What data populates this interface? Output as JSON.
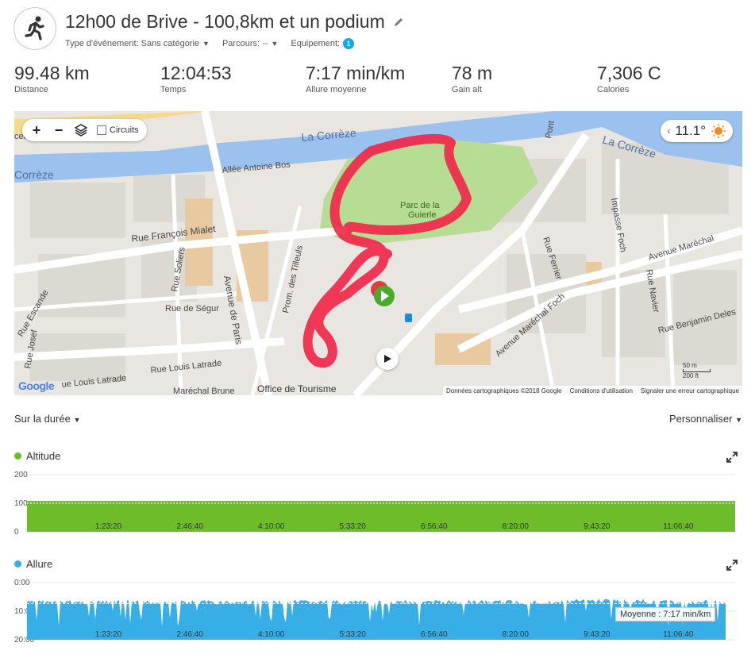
{
  "header": {
    "title": "12h00 de Brive - 100,8km et un podium",
    "meta": [
      {
        "label": "Type d'événement: Sans catégorie"
      },
      {
        "label": "Parcours: --"
      },
      {
        "label": "Equipement:",
        "badge": "1"
      }
    ]
  },
  "stats": [
    {
      "value": "99.48 km",
      "label": "Distance"
    },
    {
      "value": "12:04:53",
      "label": "Temps"
    },
    {
      "value": "7:17 min/km",
      "label": "Allure moyenne"
    },
    {
      "value": "78 m",
      "label": "Gain alt"
    },
    {
      "value": "7,306 C",
      "label": "Calories"
    }
  ],
  "map": {
    "circuits_label": "Circuits",
    "weather_temp": "11.1°",
    "streets": {
      "river_1": "La Corrèze",
      "river_2": "La Corrèze",
      "river_3": "Corrèze",
      "allee": "Allée Antoine Bos",
      "mialet": "Rue François Mialet",
      "soliers": "Rue Soliers",
      "paris": "Avenue de Paris",
      "tilleuls": "Prom. des Tilleuls",
      "segur": "Rue de Ségur",
      "escande": "Rue Escande",
      "josef": "Rue Josef",
      "latrade1": "ue Louis Latrade",
      "latrade2": "Rue Louis Latrade",
      "brune": "Maréchal Brune",
      "tourisme": "Office de Tourisme",
      "parc": "Parc de la",
      "parc2": "Guierle",
      "pont": "Pont",
      "ferrier": "Rue Ferrier",
      "impasse": "Impasse Foch",
      "navier": "Rue Navier",
      "foch": "Avenue Maréchal Foch",
      "marechal": "Avenue Maréchal",
      "delessert": "Rue Benjamin Deles",
      "celle": "celle Ro"
    },
    "google": "Google",
    "scale_m": "50 m",
    "scale_ft": "200 ft",
    "footer": [
      "Données cartographiques ©2018 Google",
      "Conditions d'utilisation",
      "Signaler une erreur cartographique"
    ],
    "route_color": "#f0284a"
  },
  "charts": {
    "range_label": "Sur la durée",
    "customize_label": "Personnaliser",
    "x_ticks": [
      "1:23:20",
      "2:46:40",
      "4:10:00",
      "5:33:20",
      "6:56:40",
      "8:20:00",
      "9:43:20",
      "11:06:40"
    ]
  },
  "chart_data": [
    {
      "type": "area",
      "title": "Altitude",
      "color": "#6dbd2a",
      "x_ticks": [
        "1:23:20",
        "2:46:40",
        "4:10:00",
        "5:33:20",
        "6:56:40",
        "8:20:00",
        "9:43:20",
        "11:06:40"
      ],
      "y_ticks": [
        "200",
        "100",
        "0"
      ],
      "ylim": [
        0,
        200
      ],
      "x_end_seconds": 43493,
      "series": [
        {
          "values_m": [
            108,
            108,
            108,
            108,
            108,
            108,
            108,
            108,
            108
          ]
        }
      ]
    },
    {
      "type": "area",
      "title": "Allure",
      "color": "#38aee6",
      "x_ticks": [
        "1:23:20",
        "2:46:40",
        "4:10:00",
        "5:33:20",
        "6:56:40",
        "8:20:00",
        "9:43:20",
        "11:06:40"
      ],
      "y_ticks": [
        "0:00",
        "10:00",
        "20:00"
      ],
      "ylim_min_per_km": [
        0,
        20
      ],
      "y_inverted": true,
      "average_label": "Moyenne : 7:17 min/km",
      "average_min_per_km": 7.28
    }
  ]
}
